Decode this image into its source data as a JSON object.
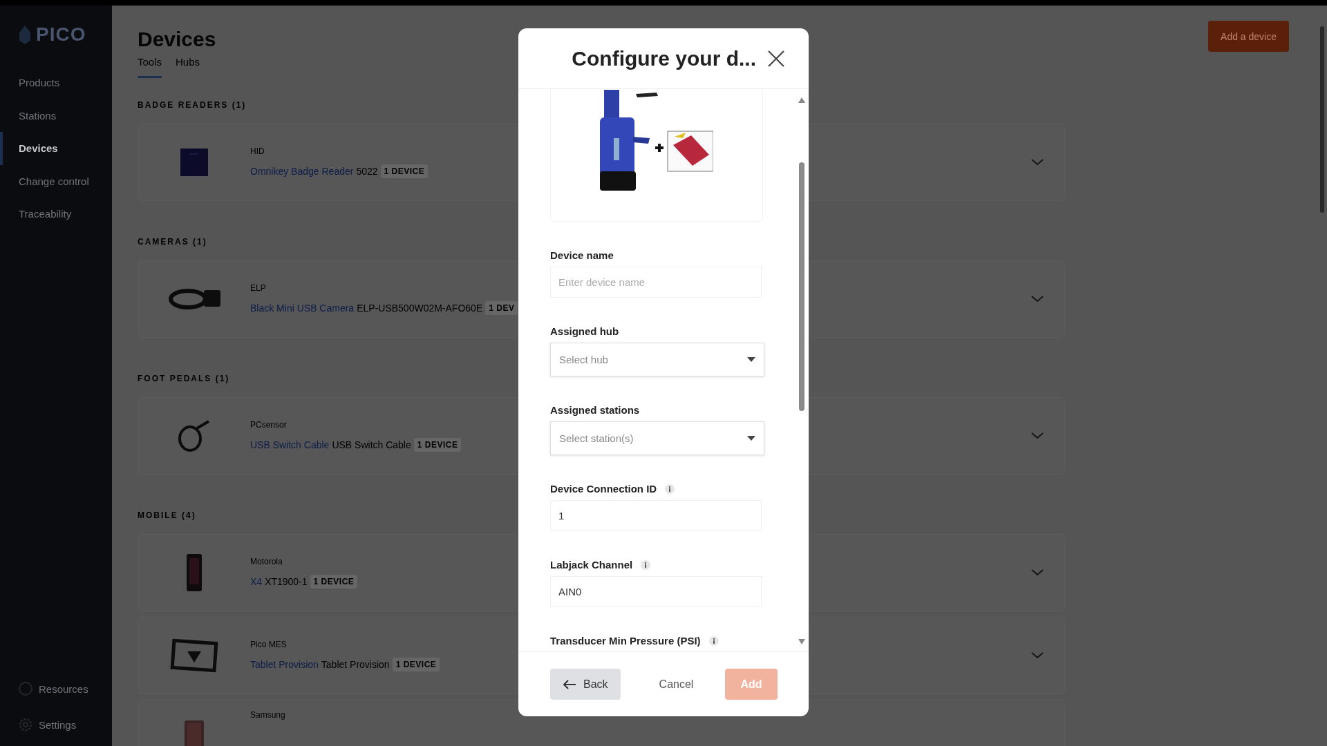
{
  "sidebar": {
    "logo": "PICO",
    "items": [
      {
        "label": "Products",
        "selected": false
      },
      {
        "label": "Stations",
        "selected": false
      },
      {
        "label": "Devices",
        "selected": true
      },
      {
        "label": "Change control",
        "selected": false
      },
      {
        "label": "Traceability",
        "selected": false
      }
    ],
    "bottom_items": [
      {
        "label": "Resources",
        "kind": "help"
      },
      {
        "label": "Settings",
        "kind": "gear"
      }
    ]
  },
  "page": {
    "title": "Devices",
    "add_button": "Add a device",
    "tabs": [
      {
        "label": "Tools",
        "selected": true
      },
      {
        "label": "Hubs",
        "selected": false
      }
    ]
  },
  "sections": [
    {
      "heading": "BADGE READERS (1)",
      "devices": [
        {
          "maker": "HID",
          "name": "Omnikey Badge Reader",
          "model": "5022",
          "badge": "1 DEVICE"
        }
      ]
    },
    {
      "heading": "CAMERAS (1)",
      "devices": [
        {
          "maker": "ELP",
          "name": "Black Mini USB Camera",
          "model": "ELP-USB500W02M-AFO60E",
          "badge": "1 DEV"
        }
      ]
    },
    {
      "heading": "FOOT PEDALS (1)",
      "devices": [
        {
          "maker": "PCsensor",
          "name": "USB Switch Cable",
          "model": "USB Switch Cable",
          "badge": "1 DEVICE"
        }
      ]
    },
    {
      "heading": "MOBILE (4)",
      "devices": [
        {
          "maker": "Motorola",
          "name": "X4",
          "model": "XT1900-1",
          "badge": "1 DEVICE"
        },
        {
          "maker": "Pico MES",
          "name": "Tablet Provision",
          "model": "Tablet Provision",
          "badge": "1 DEVICE"
        },
        {
          "maker": "Samsung"
        }
      ]
    }
  ],
  "modal": {
    "title": "Configure your d...",
    "fields": [
      {
        "kind": "text",
        "label": "Device name",
        "placeholder": "Enter device name",
        "info": false
      },
      {
        "kind": "select",
        "label": "Assigned hub",
        "placeholder": "Select hub",
        "info": false
      },
      {
        "kind": "select",
        "label": "Assigned stations",
        "placeholder": "Select station(s)",
        "info": false
      },
      {
        "kind": "text",
        "label": "Device Connection ID",
        "value": "1",
        "info": true
      },
      {
        "kind": "text",
        "label": "Labjack Channel",
        "value": "AIN0",
        "info": true
      },
      {
        "kind": "label",
        "label": "Transducer Min Pressure (PSI)",
        "info": true
      }
    ],
    "buttons": [
      {
        "kind": "back",
        "label": "Back"
      },
      {
        "kind": "cancel",
        "label": "Cancel"
      },
      {
        "kind": "add",
        "label": "Add",
        "disabled": true
      }
    ]
  }
}
